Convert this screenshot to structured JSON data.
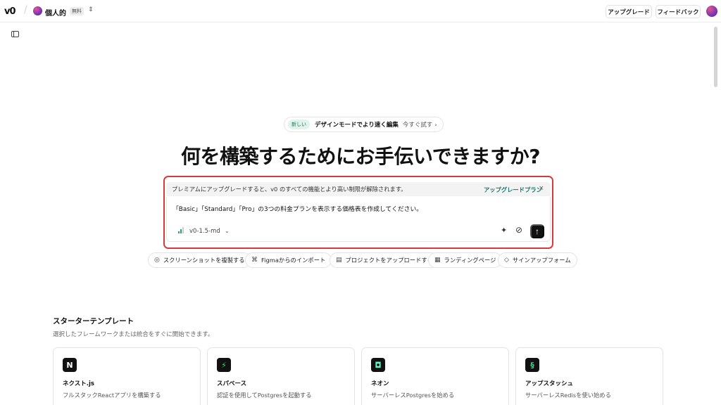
{
  "header": {
    "logo": "v0",
    "workspace": {
      "name": "個人的",
      "badge": "無料",
      "switch_icon": "chevron-up-down-icon"
    },
    "upgrade_label": "アップグレード",
    "feedback_label": "フィードバック"
  },
  "announcement": {
    "badge": "新しい",
    "text": "デザインモードでより速く編集",
    "cta": "今すぐ試す",
    "chevron": "›"
  },
  "hero_title": "何を構築するためにお手伝いできますか?",
  "upsell": {
    "text": "プレミアムにアップグレードすると、v0 のすべての機能とより高い制限が解除されます。",
    "link": "アップグレードプラン",
    "close": "×"
  },
  "prompt": {
    "text": "「Basic」「Standard」「Pro」の3つの料金プランを表示する価格表を作成してください。",
    "model": "v0-1.5-md",
    "model_chevron": "⌄",
    "send_glyph": "↑"
  },
  "quick_actions": [
    {
      "icon": "◎",
      "label": "スクリーンショットを複製する"
    },
    {
      "icon": "⌘",
      "label": "Figmaからのインポート"
    },
    {
      "icon": "▤",
      "label": "プロジェクトをアップロードする"
    },
    {
      "icon": "▦",
      "label": "ランディングページ"
    },
    {
      "icon": "◇",
      "label": "サインアップフォーム"
    }
  ],
  "templates": {
    "heading": "スターターテンプレート",
    "subtitle": "選択したフレームワークまたは統合をすぐに開始できます。",
    "cards": [
      {
        "icon": "N",
        "title": "ネクスト.js",
        "desc": "フルスタックReactアプリを構築する"
      },
      {
        "icon": "⚡",
        "title": "スパベース",
        "desc": "認証を使用してPostgresを起動する"
      },
      {
        "icon": "◘",
        "title": "ネオン",
        "desc": "サーバーレスPostgresを始める"
      },
      {
        "icon": "§",
        "title": "アップスタッシュ",
        "desc": "サーバーレスRedisを使い始める"
      }
    ]
  },
  "colors": {
    "accent_green": "#0f7b6c",
    "highlight_red": "#d63a3a",
    "supabase_green": "#3ecf8e"
  }
}
